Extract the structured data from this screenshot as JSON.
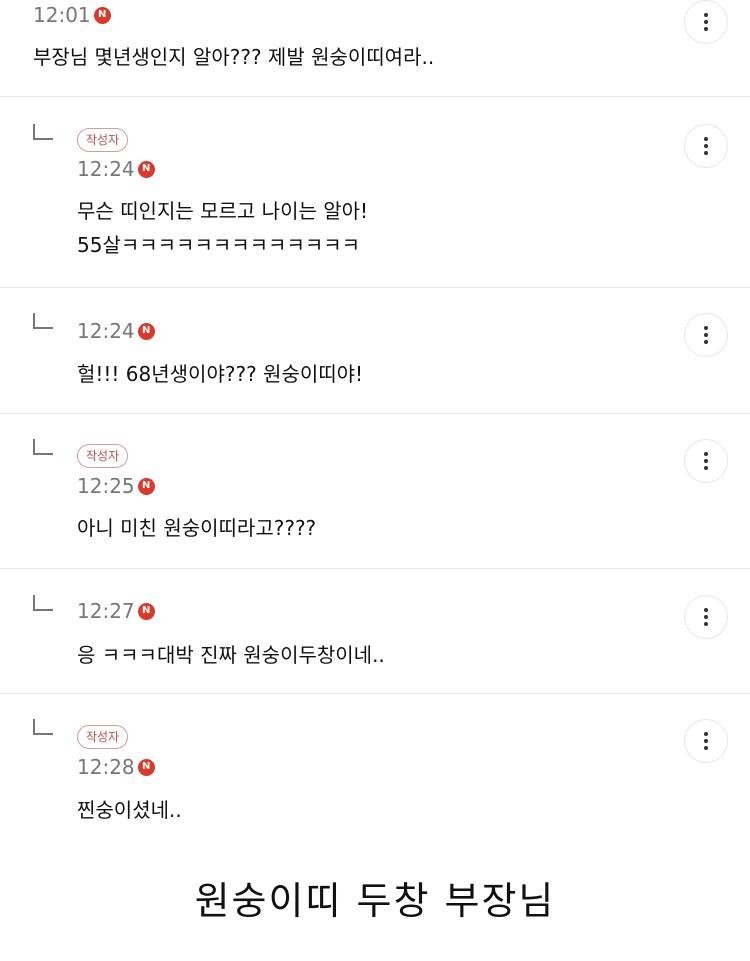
{
  "icons": {
    "naver": "N",
    "more": "vertical-ellipsis-icon",
    "reply": "reply-corner-icon"
  },
  "colors": {
    "badge_red": "#c0504d",
    "n_icon_red": "#d93a2b",
    "time_gray": "#777777"
  },
  "comments": [
    {
      "badge": "",
      "time": "12:01",
      "lines": [
        "부장님 몇년생인지 알아??? 제발 원숭이띠여라.."
      ]
    },
    {
      "badge": "작성자",
      "time": "12:24",
      "lines": [
        "무슨 띠인지는 모르고 나이는 알아!",
        "55살ㅋㅋㅋㅋㅋㅋㅋㅋㅋㅋㅋㅋㅋ"
      ]
    },
    {
      "badge": "",
      "time": "12:24",
      "lines": [
        "헐!!! 68년생이야??? 원숭이띠야!"
      ]
    },
    {
      "badge": "작성자",
      "time": "12:25",
      "lines": [
        "아니 미친 원숭이띠라고????"
      ]
    },
    {
      "badge": "",
      "time": "12:27",
      "lines": [
        "응 ㅋㅋㅋ대박 진짜 원숭이두창이네.."
      ]
    },
    {
      "badge": "작성자",
      "time": "12:28",
      "lines": [
        "찐숭이셨네.."
      ]
    }
  ],
  "caption": "원숭이띠 두창 부장님"
}
